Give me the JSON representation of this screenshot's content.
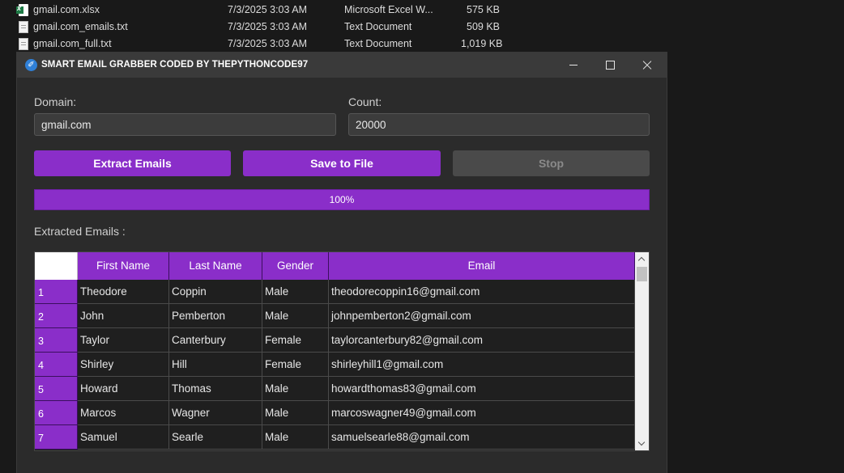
{
  "explorer": {
    "files": [
      {
        "name": "gmail.com.xlsx",
        "date": "7/3/2025 3:03 AM",
        "type": "Microsoft Excel W...",
        "size": "575 KB",
        "icon": "excel-file-icon"
      },
      {
        "name": "gmail.com_emails.txt",
        "date": "7/3/2025 3:03 AM",
        "type": "Text Document",
        "size": "509 KB",
        "icon": "text-file-icon"
      },
      {
        "name": "gmail.com_full.txt",
        "date": "7/3/2025 3:03 AM",
        "type": "Text Document",
        "size": "1,019 KB",
        "icon": "text-file-icon"
      }
    ]
  },
  "window": {
    "title": "SMART EMAIL GRABBER CODED BY THEPYTHONCODE97",
    "icon": "app-logo-icon",
    "controls": {
      "minimize": "minimize-icon",
      "maximize": "maximize-icon",
      "close": "close-icon"
    }
  },
  "form": {
    "domain_label": "Domain:",
    "domain_value": "gmail.com",
    "count_label": "Count:",
    "count_value": "20000"
  },
  "buttons": {
    "extract": "Extract Emails",
    "save": "Save to File",
    "stop": "Stop"
  },
  "progress": {
    "value": 100,
    "label": "100%"
  },
  "results": {
    "label": "Extracted Emails :",
    "columns": [
      "First Name",
      "Last Name",
      "Gender",
      "Email"
    ],
    "rows": [
      {
        "index": "1",
        "first": "Theodore",
        "last": "Coppin",
        "gender": "Male",
        "email": "theodorecoppin16@gmail.com"
      },
      {
        "index": "2",
        "first": "John",
        "last": "Pemberton",
        "gender": "Male",
        "email": "johnpemberton2@gmail.com"
      },
      {
        "index": "3",
        "first": "Taylor",
        "last": "Canterbury",
        "gender": "Female",
        "email": "taylorcanterbury82@gmail.com"
      },
      {
        "index": "4",
        "first": "Shirley",
        "last": "Hill",
        "gender": "Female",
        "email": "shirleyhill1@gmail.com"
      },
      {
        "index": "5",
        "first": "Howard",
        "last": "Thomas",
        "gender": "Male",
        "email": "howardthomas83@gmail.com"
      },
      {
        "index": "6",
        "first": "Marcos",
        "last": "Wagner",
        "gender": "Male",
        "email": "marcoswagner49@gmail.com"
      },
      {
        "index": "7",
        "first": "Samuel",
        "last": "Searle",
        "gender": "Male",
        "email": "samuelsearle88@gmail.com"
      }
    ]
  },
  "colors": {
    "accent": "#8a2ec9",
    "window_bg": "#2b2b2b",
    "titlebar_bg": "#3a3a3a"
  }
}
